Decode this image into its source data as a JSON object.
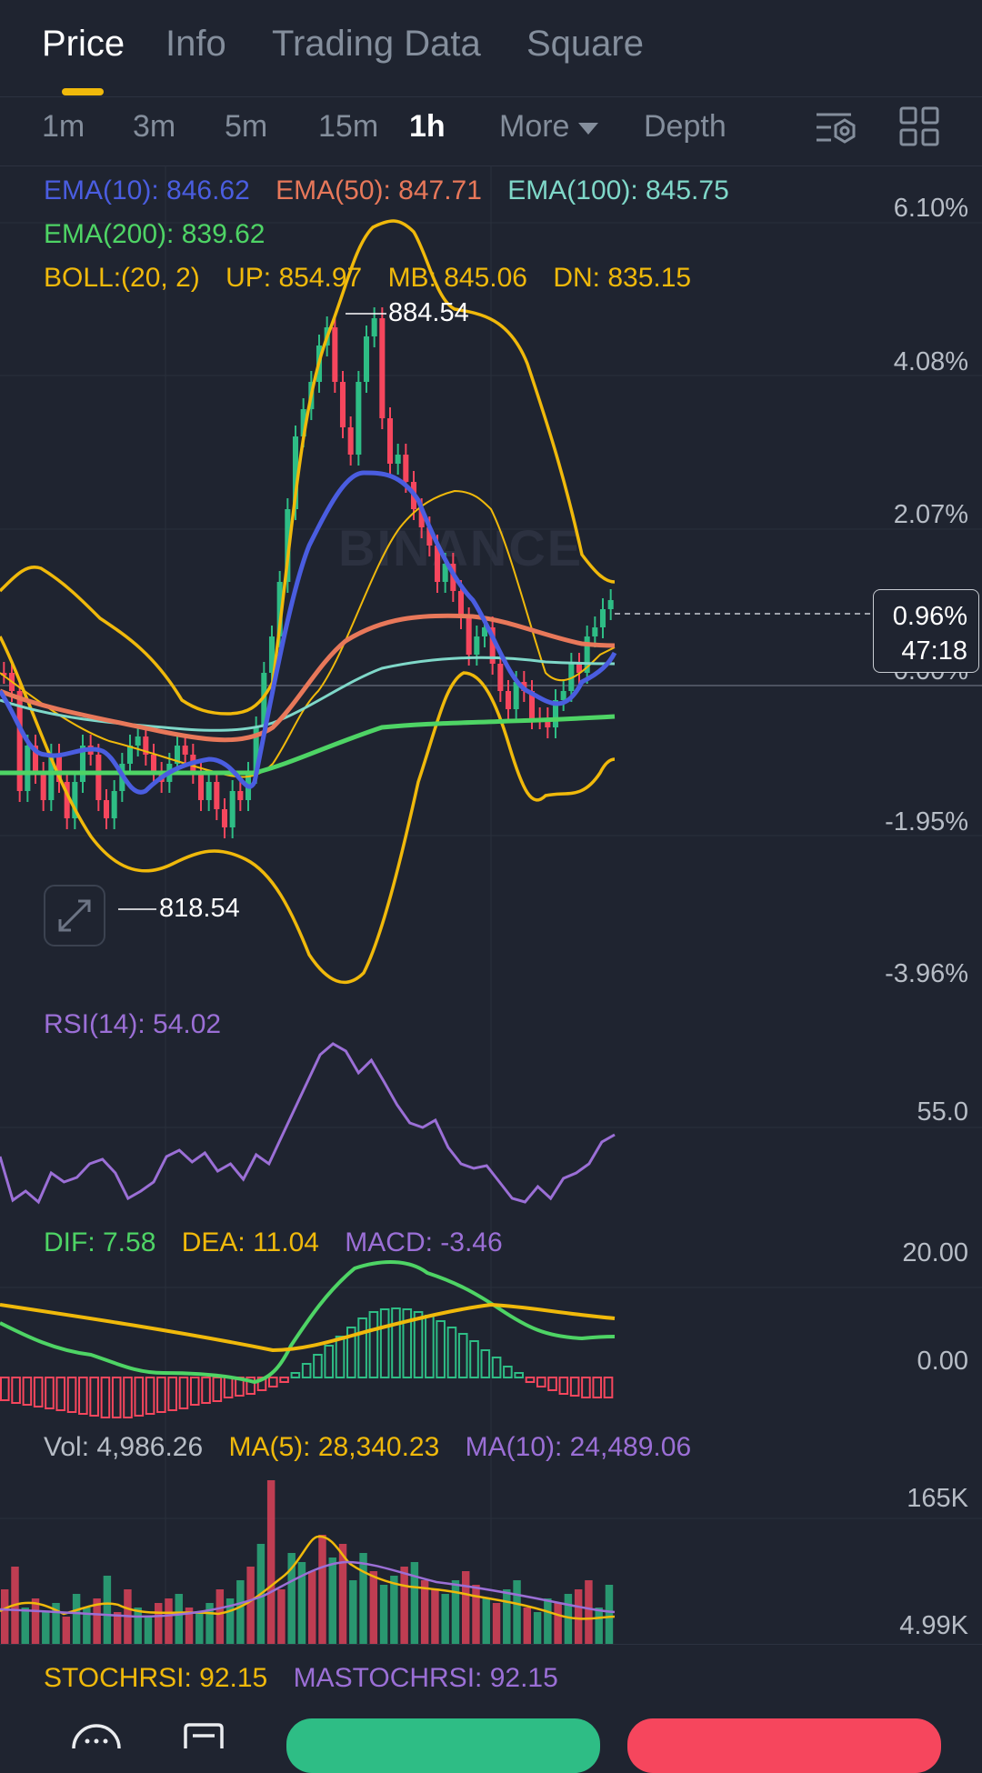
{
  "tabs": [
    {
      "label": "Price"
    },
    {
      "label": "Info"
    },
    {
      "label": "Trading Data"
    },
    {
      "label": "Square"
    }
  ],
  "intervals": [
    "1m",
    "3m",
    "5m",
    "15m",
    "1h",
    "More",
    "Depth"
  ],
  "active_interval": "1h",
  "main_indicators": {
    "ema10": "EMA(10): 846.62",
    "ema50": "EMA(50): 847.71",
    "ema100": "EMA(100): 845.75",
    "ema200": "EMA(200): 839.62",
    "boll": "BOLL:(20, 2)",
    "boll_up": "UP: 854.97",
    "boll_mb": "MB: 845.06",
    "boll_dn": "DN: 835.15"
  },
  "price_axis": [
    "6.10%",
    "4.08%",
    "2.07%",
    "0.00%",
    "-1.95%",
    "-3.96%"
  ],
  "current_tag": {
    "pct": "0.96%",
    "countdown": "47:18"
  },
  "high_label": "884.54",
  "low_label": "818.54",
  "watermark": "BINANCE",
  "rsi": {
    "label": "RSI(14): 54.02",
    "axis": "55.0"
  },
  "macd": {
    "dif": "DIF: 7.58",
    "dea": "DEA: 11.04",
    "macd": "MACD: -3.46",
    "axis_top": "20.00",
    "axis_zero": "0.00"
  },
  "volume": {
    "vol": "Vol: 4,986.26",
    "ma5": "MA(5): 28,340.23",
    "ma10": "MA(10): 24,489.06",
    "axis_top": "165K",
    "axis_bottom": "4.99K"
  },
  "stochrsi": {
    "stoch": "STOCHRSI: 92.15",
    "ma": "MASTOCHRSI: 92.15"
  },
  "colors": {
    "up": "#2ebd85",
    "down": "#f6465d",
    "ema10": "#4a5de0",
    "ema50": "#e8785a",
    "ema100": "#7fd8c9",
    "ema200": "#4ed465",
    "boll": "#f0b90b",
    "rsi": "#9b6fd6"
  }
}
